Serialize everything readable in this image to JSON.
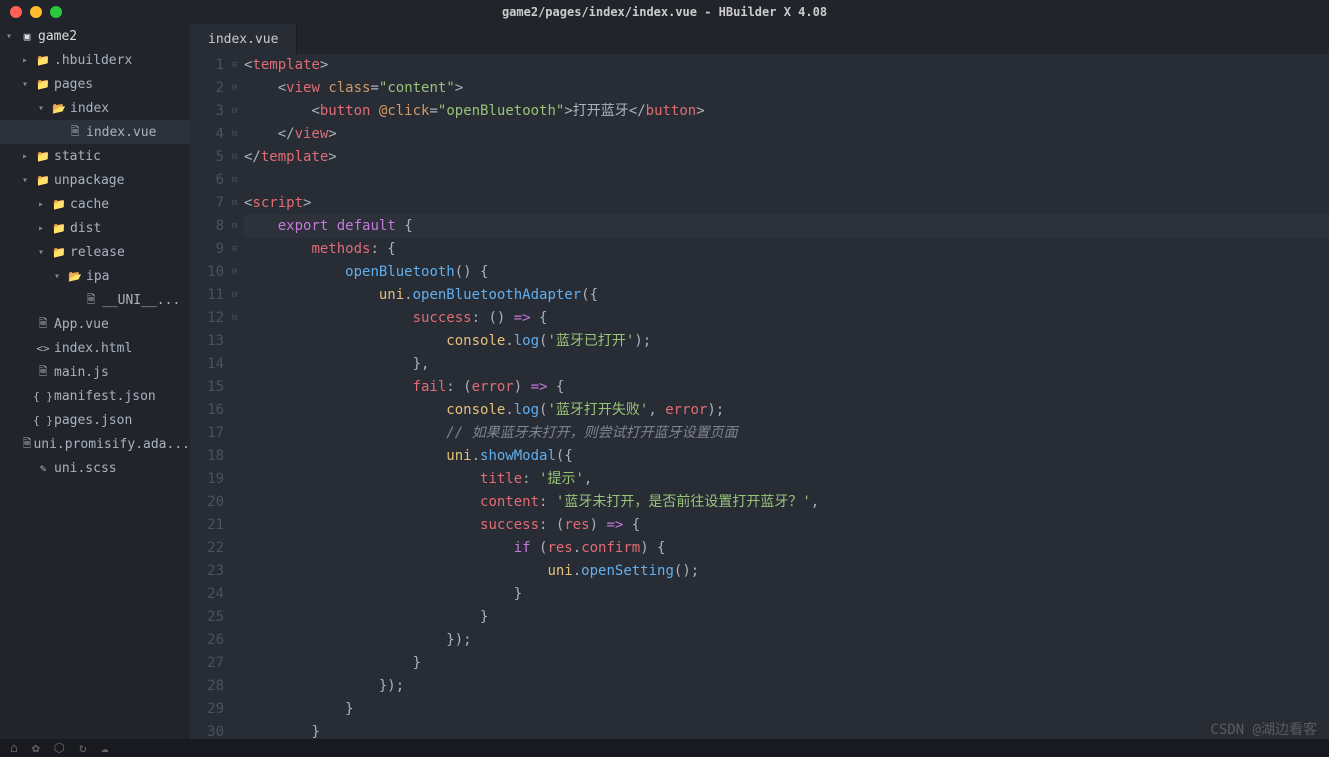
{
  "titlebar": {
    "title": "game2/pages/index/index.vue - HBuilder X 4.08"
  },
  "sidebar": {
    "root": "game2",
    "items": [
      {
        "label": ".hbuilderx",
        "icon": "folder",
        "depth": 1,
        "expanded": false
      },
      {
        "label": "pages",
        "icon": "folder",
        "depth": 1,
        "expanded": true
      },
      {
        "label": "index",
        "icon": "folder-open",
        "depth": 2,
        "expanded": true
      },
      {
        "label": "index.vue",
        "icon": "file",
        "depth": 3,
        "selected": true
      },
      {
        "label": "static",
        "icon": "folder",
        "depth": 1,
        "expanded": false
      },
      {
        "label": "unpackage",
        "icon": "folder",
        "depth": 1,
        "expanded": true
      },
      {
        "label": "cache",
        "icon": "folder",
        "depth": 2,
        "expanded": false
      },
      {
        "label": "dist",
        "icon": "folder",
        "depth": 2,
        "expanded": false
      },
      {
        "label": "release",
        "icon": "folder",
        "depth": 2,
        "expanded": true
      },
      {
        "label": "ipa",
        "icon": "folder-open",
        "depth": 3,
        "expanded": true
      },
      {
        "label": "__UNI__...",
        "icon": "file",
        "depth": 4
      },
      {
        "label": "App.vue",
        "icon": "file",
        "depth": 1
      },
      {
        "label": "index.html",
        "icon": "html",
        "depth": 1
      },
      {
        "label": "main.js",
        "icon": "file",
        "depth": 1
      },
      {
        "label": "manifest.json",
        "icon": "json",
        "depth": 1
      },
      {
        "label": "pages.json",
        "icon": "json",
        "depth": 1
      },
      {
        "label": "uni.promisify.ada...",
        "icon": "file",
        "depth": 1
      },
      {
        "label": "uni.scss",
        "icon": "scss",
        "depth": 1
      }
    ]
  },
  "tabs": [
    {
      "label": "index.vue"
    }
  ],
  "editor": {
    "lines": [
      {
        "n": 1,
        "fold": "⊟",
        "html": "<span class='c-punc'>&lt;</span><span class='c-tag'>template</span><span class='c-punc'>&gt;</span>"
      },
      {
        "n": 2,
        "fold": "⊟",
        "html": "    <span class='c-punc'>&lt;</span><span class='c-tag'>view</span> <span class='c-attr'>class</span><span class='c-punc'>=</span><span class='c-str'>\"content\"</span><span class='c-punc'>&gt;</span>"
      },
      {
        "n": 3,
        "fold": "",
        "html": "        <span class='c-punc'>&lt;</span><span class='c-tag'>button</span> <span class='c-attr'>@click</span><span class='c-punc'>=</span><span class='c-str'>\"openBluetooth\"</span><span class='c-punc'>&gt;</span><span class='c-plain'>打开蓝牙</span><span class='c-punc'>&lt;/</span><span class='c-tag'>button</span><span class='c-punc'>&gt;</span>"
      },
      {
        "n": 4,
        "fold": "",
        "html": "    <span class='c-punc'>&lt;/</span><span class='c-tag'>view</span><span class='c-punc'>&gt;</span>"
      },
      {
        "n": 5,
        "fold": "",
        "html": "<span class='c-punc'>&lt;/</span><span class='c-tag'>template</span><span class='c-punc'>&gt;</span>"
      },
      {
        "n": 6,
        "fold": "",
        "html": " "
      },
      {
        "n": 7,
        "fold": "⊟",
        "html": "<span class='c-punc'>&lt;</span><span class='c-tag'>script</span><span class='c-punc'>&gt;</span>"
      },
      {
        "n": 8,
        "fold": "⊟",
        "hl": true,
        "html": "    <span class='c-kw'>export</span> <span class='c-kw'>default</span> <span class='c-punc'>{</span>"
      },
      {
        "n": 9,
        "fold": "⊟",
        "html": "        <span class='c-prop'>methods</span><span class='c-punc'>: {</span>"
      },
      {
        "n": 10,
        "fold": "⊟",
        "html": "            <span class='c-fn'>openBluetooth</span><span class='c-punc'>() {</span>"
      },
      {
        "n": 11,
        "fold": "⊟",
        "html": "                <span class='c-obj'>uni</span><span class='c-punc'>.</span><span class='c-fn'>openBluetoothAdapter</span><span class='c-punc'>({</span>"
      },
      {
        "n": 12,
        "fold": "⊟",
        "html": "                    <span class='c-prop'>success</span><span class='c-punc'>: () </span><span class='c-kw'>=&gt;</span><span class='c-punc'> {</span>"
      },
      {
        "n": 13,
        "fold": "",
        "html": "                        <span class='c-obj'>console</span><span class='c-punc'>.</span><span class='c-fn'>log</span><span class='c-punc'>(</span><span class='c-str'>'蓝牙已打开'</span><span class='c-punc'>);</span>"
      },
      {
        "n": 14,
        "fold": "",
        "html": "                    <span class='c-punc'>},</span>"
      },
      {
        "n": 15,
        "fold": "⊟",
        "html": "                    <span class='c-prop'>fail</span><span class='c-punc'>: (</span><span class='c-var'>error</span><span class='c-punc'>) </span><span class='c-kw'>=&gt;</span><span class='c-punc'> {</span>"
      },
      {
        "n": 16,
        "fold": "",
        "html": "                        <span class='c-obj'>console</span><span class='c-punc'>.</span><span class='c-fn'>log</span><span class='c-punc'>(</span><span class='c-str'>'蓝牙打开失败'</span><span class='c-punc'>, </span><span class='c-var'>error</span><span class='c-punc'>);</span>"
      },
      {
        "n": 17,
        "fold": "",
        "html": "                        <span class='c-com'>// 如果蓝牙未打开，则尝试打开蓝牙设置页面</span>"
      },
      {
        "n": 18,
        "fold": "⊟",
        "html": "                        <span class='c-obj'>uni</span><span class='c-punc'>.</span><span class='c-fn'>showModal</span><span class='c-punc'>({</span>"
      },
      {
        "n": 19,
        "fold": "",
        "html": "                            <span class='c-prop'>title</span><span class='c-punc'>: </span><span class='c-str'>'提示'</span><span class='c-punc'>,</span>"
      },
      {
        "n": 20,
        "fold": "",
        "html": "                            <span class='c-prop'>content</span><span class='c-punc'>: </span><span class='c-str'>'蓝牙未打开，是否前往设置打开蓝牙？'</span><span class='c-punc'>,</span>"
      },
      {
        "n": 21,
        "fold": "⊟",
        "html": "                            <span class='c-prop'>success</span><span class='c-punc'>: (</span><span class='c-var'>res</span><span class='c-punc'>) </span><span class='c-kw'>=&gt;</span><span class='c-punc'> {</span>"
      },
      {
        "n": 22,
        "fold": "⊟",
        "html": "                                <span class='c-kw'>if</span> <span class='c-punc'>(</span><span class='c-var'>res</span><span class='c-punc'>.</span><span class='c-prop'>confirm</span><span class='c-punc'>) {</span>"
      },
      {
        "n": 23,
        "fold": "",
        "html": "                                    <span class='c-obj'>uni</span><span class='c-punc'>.</span><span class='c-fn'>openSetting</span><span class='c-punc'>();</span>"
      },
      {
        "n": 24,
        "fold": "",
        "html": "                                <span class='c-punc'>}</span>"
      },
      {
        "n": 25,
        "fold": "",
        "html": "                            <span class='c-punc'>}</span>"
      },
      {
        "n": 26,
        "fold": "",
        "html": "                        <span class='c-punc'>});</span>"
      },
      {
        "n": 27,
        "fold": "",
        "html": "                    <span class='c-punc'>}</span>"
      },
      {
        "n": 28,
        "fold": "",
        "html": "                <span class='c-punc'>});</span>"
      },
      {
        "n": 29,
        "fold": "",
        "html": "            <span class='c-punc'>}</span>"
      },
      {
        "n": 30,
        "fold": "",
        "html": "        <span class='c-punc'>}</span>"
      }
    ]
  },
  "statusbar": {
    "icons": [
      "⌂",
      "✿",
      "⬡",
      "↻",
      "☁"
    ]
  },
  "watermark": "CSDN @湖边看客"
}
